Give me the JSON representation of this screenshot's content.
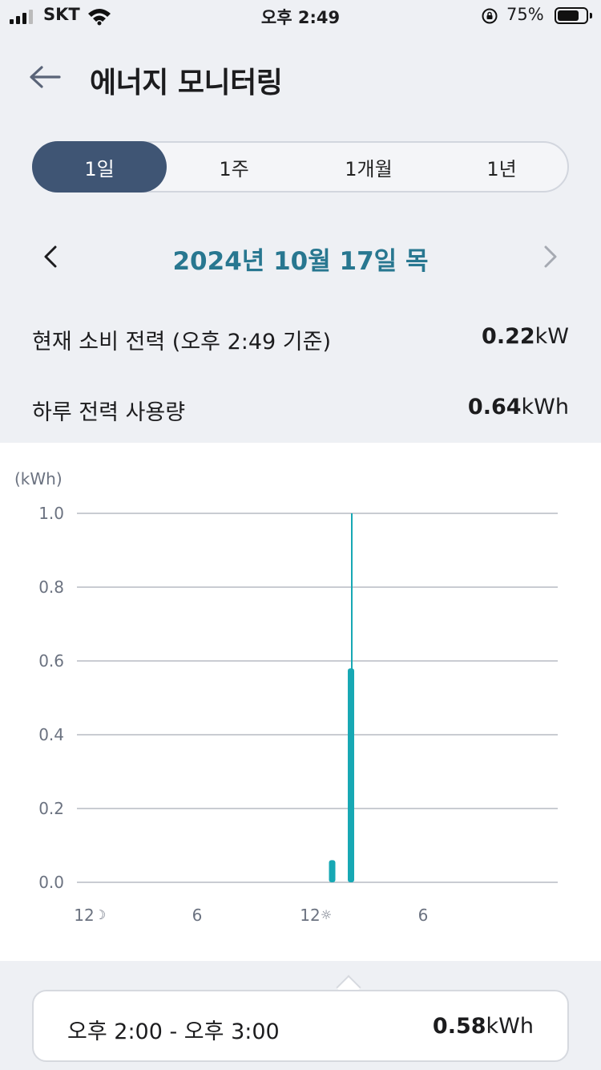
{
  "status_bar": {
    "carrier": "SKT",
    "time": "오후 2:49",
    "battery_percent": "75%",
    "battery_level": 0.75
  },
  "header": {
    "title": "에너지 모니터링",
    "back_icon": "arrow-left-icon"
  },
  "period_tabs": [
    {
      "label": "1일",
      "active": true
    },
    {
      "label": "1주",
      "active": false
    },
    {
      "label": "1개월",
      "active": false
    },
    {
      "label": "1년",
      "active": false
    }
  ],
  "date_nav": {
    "label": "2024년 10월 17일 목",
    "prev_icon": "chevron-left-icon",
    "next_icon": "chevron-right-icon"
  },
  "stats": {
    "current_label": "현재 소비 전력 (오후 2:49 기준)",
    "current_value": "0.22",
    "current_unit": "kW",
    "daily_label": "하루 전력 사용량",
    "daily_value": "0.64",
    "daily_unit": "kWh"
  },
  "colors": {
    "accent": "#3f5574",
    "date": "#287790",
    "bar": "#17a8b4"
  },
  "chart_data": {
    "type": "bar",
    "ylabel": "(kWh)",
    "ylim": [
      0,
      1.0
    ],
    "yticks": [
      "0.0",
      "0.2",
      "0.4",
      "0.6",
      "0.8",
      "1.0"
    ],
    "xticks": [
      {
        "hour": 0,
        "label": "12",
        "icon": "moon-icon",
        "glyph": "☽"
      },
      {
        "hour": 6,
        "label": "6",
        "icon": "",
        "glyph": ""
      },
      {
        "hour": 12,
        "label": "12",
        "icon": "sun-icon",
        "glyph": "☼"
      },
      {
        "hour": 18,
        "label": "6",
        "icon": "",
        "glyph": ""
      }
    ],
    "x_range": [
      0,
      24
    ],
    "bars": [
      {
        "hour": 13,
        "value": 0.06
      },
      {
        "hour": 14,
        "value": 0.58
      }
    ],
    "selected_hour": 14,
    "grid": true
  },
  "tooltip": {
    "range": "오후 2:00 - 오후 3:00",
    "value": "0.58",
    "unit": "kWh"
  }
}
